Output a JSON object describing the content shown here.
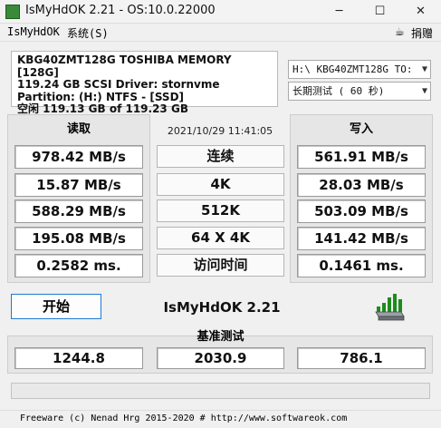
{
  "window": {
    "title": "IsMyHdOK 2.21 - OS:10.0.22000",
    "minimize": "─",
    "maximize": "☐",
    "close": "✕"
  },
  "menu": {
    "app": "IsMyHdOK",
    "system": "系统(S)",
    "donate": "捐赠"
  },
  "drive_info": {
    "line1": "KBG40ZMT128G TOSHIBA MEMORY [128G]",
    "line2": "119.24 GB  SCSI Driver: stornvme",
    "line3": "Partition: (H:) NTFS - [SSD]",
    "line4": "空闲 119.13 GB of 119.23 GB"
  },
  "drive_select": {
    "value": "H:\\ KBG40ZMT128G TO:"
  },
  "test_select": {
    "value": "长期测试 ( 60 秒)"
  },
  "timestamp": "2021/10/29 11:41:05",
  "read": {
    "title": "读取",
    "values": [
      "978.42 MB/s",
      "15.87 MB/s",
      "588.29 MB/s",
      "195.08 MB/s",
      "0.2582 ms."
    ]
  },
  "write": {
    "title": "写入",
    "values": [
      "561.91 MB/s",
      "28.03 MB/s",
      "503.09 MB/s",
      "141.42 MB/s",
      "0.1461 ms."
    ]
  },
  "tests": [
    "连续",
    "4K",
    "512K",
    "64 X 4K",
    "访问时间"
  ],
  "start_button": "开始",
  "brand": "IsMyHdOK 2.21",
  "benchmark": {
    "title": "基准测试",
    "values": [
      "1244.8",
      "2030.9",
      "786.1"
    ]
  },
  "status": "Freeware (c) Nenad Hrg 2015-2020 # http://www.softwareok.com"
}
